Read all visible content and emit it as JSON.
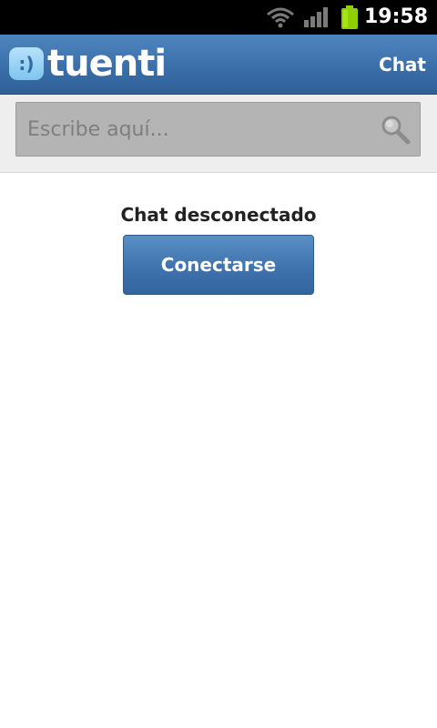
{
  "status_bar": {
    "time": "19:58",
    "icons": [
      "wifi-icon",
      "signal-icon",
      "battery-icon"
    ],
    "battery_color": "#8fd100"
  },
  "header": {
    "logo_symbol": ":)",
    "logo_text": "tuenti",
    "title": "Chat",
    "background_color": "#3b6fa9"
  },
  "search": {
    "placeholder": "Escribe aquí...",
    "value": "",
    "icon": "search-icon"
  },
  "main": {
    "status_text": "Chat desconectado",
    "connect_button_label": "Conectarse",
    "accent_color": "#3f73ad"
  }
}
